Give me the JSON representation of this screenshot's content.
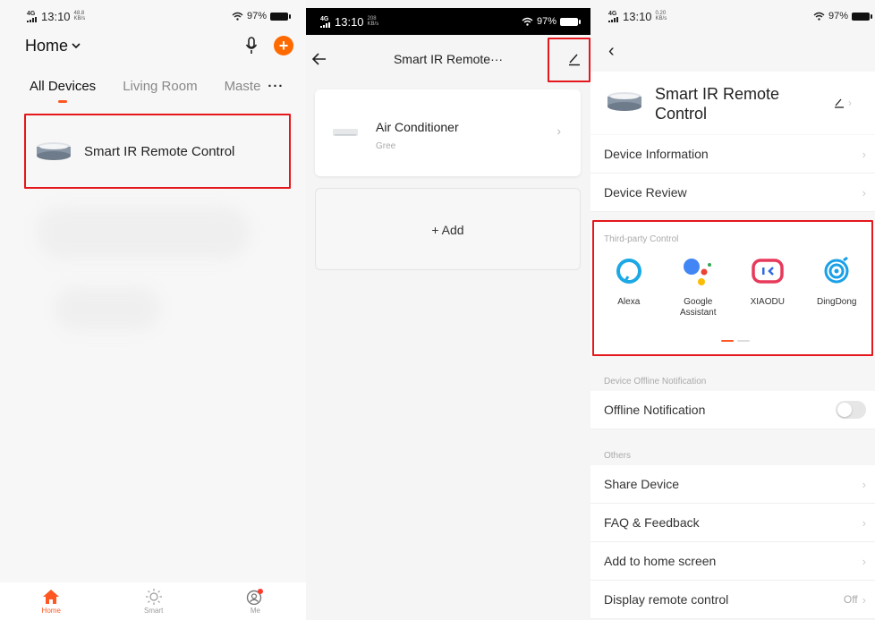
{
  "status_bars": [
    {
      "time": "13:10",
      "network": "4G",
      "speed": "48.8 KB/s",
      "battery": "97%"
    },
    {
      "time": "13:10",
      "network": "4G",
      "speed": "208 KB/s",
      "battery": "97%"
    },
    {
      "time": "13:10",
      "network": "4G",
      "speed": "0.20 KB/s",
      "battery": "97%"
    }
  ],
  "home": {
    "title": "Home",
    "tabs": [
      "All Devices",
      "Living Room",
      "Maste"
    ],
    "more": "···",
    "plus": "+",
    "device_name": "Smart IR Remote Control",
    "nav": [
      {
        "label": "Home",
        "icon": "home-icon"
      },
      {
        "label": "Smart",
        "icon": "sun-icon"
      },
      {
        "label": "Me",
        "icon": "user-icon"
      }
    ]
  },
  "remote": {
    "title": "Smart IR Remote···",
    "back": "←",
    "edit": "⁄",
    "device": {
      "name": "Air Conditioner",
      "brand": "Gree"
    },
    "chevron": "›",
    "add_label": "+ Add"
  },
  "settings": {
    "back": "‹",
    "device_name": "Smart IR Remote Control",
    "rows_top": [
      "Device Information",
      "Device Review"
    ],
    "third_party_title": "Third-party Control",
    "third_party": [
      {
        "label": "Alexa",
        "icon": "alexa-icon",
        "color": "#1ca8e5"
      },
      {
        "label": "Google Assistant",
        "icon": "google-assistant-icon",
        "color": "#4285f4"
      },
      {
        "label": "XIAODU",
        "icon": "xiaodu-icon",
        "color": "#e73a5b"
      },
      {
        "label": "DingDong",
        "icon": "dingdong-icon",
        "color": "#1aa0e8"
      }
    ],
    "offline_section": "Device Offline Notification",
    "offline_row": "Offline Notification",
    "others_section": "Others",
    "rows_others": [
      "Share Device",
      "FAQ & Feedback",
      "Add to home screen",
      "Display remote control"
    ],
    "display_value": "Off",
    "chevron": "›"
  },
  "colors": {
    "accent": "#ff5722",
    "highlight": "#e5171c"
  }
}
